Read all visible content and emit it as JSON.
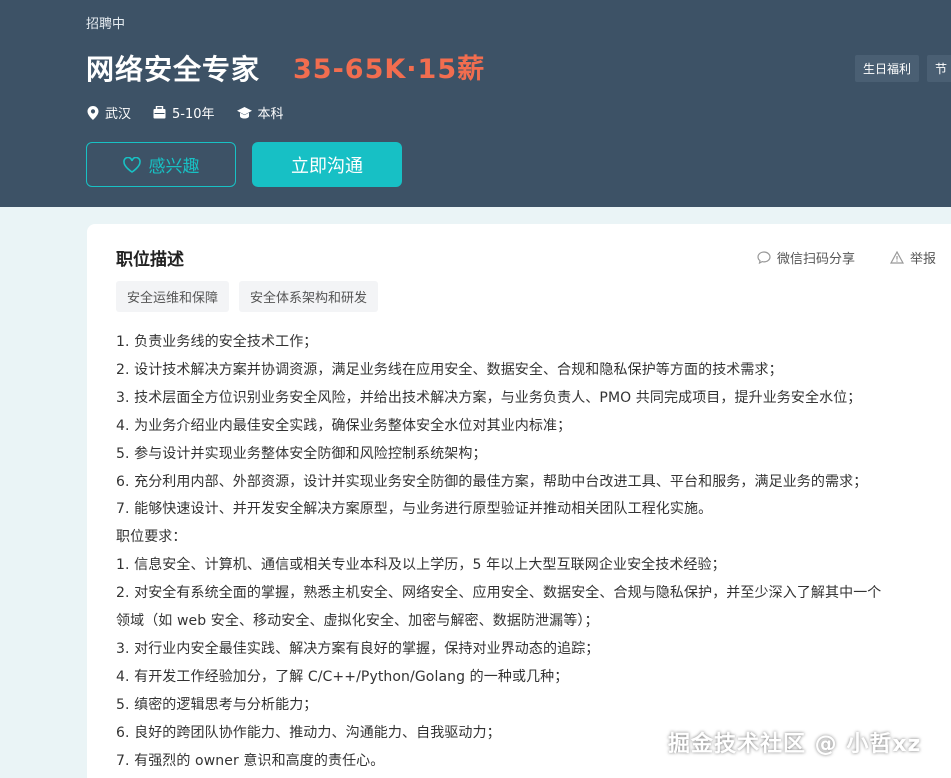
{
  "header": {
    "status": "招聘中",
    "title": "网络安全专家",
    "salary": "35-65K·15薪",
    "benefits": [
      "生日福利",
      "节"
    ],
    "meta": {
      "location": "武汉",
      "experience": "5-10年",
      "education": "本科"
    },
    "interest_label": "感兴趣",
    "chat_label": "立即沟通"
  },
  "job": {
    "section_title": "职位描述",
    "share_label": "微信扫码分享",
    "report_label": "举报",
    "tags": [
      "安全运维和保障",
      "安全体系架构和研发"
    ],
    "description_lines": [
      "1. 负责业务线的安全技术工作；",
      "2. 设计技术解决方案并协调资源，满足业务线在应用安全、数据安全、合规和隐私保护等方面的技术需求；",
      "3. 技术层面全方位识别业务安全风险，并给出技术解决方案，与业务负责人、PMO 共同完成项目，提升业务安全水位；",
      "4. 为业务介绍业内最佳安全实践，确保业务整体安全水位对其业内标准；",
      "5. 参与设计并实现业务整体安全防御和风险控制系统架构；",
      "6. 充分利用内部、外部资源，设计并实现业务安全防御的最佳方案，帮助中台改进工具、平台和服务，满足业务的需求；",
      "7. 能够快速设计、并开发安全解决方案原型，与业务进行原型验证并推动相关团队工程化实施。",
      "职位要求：",
      "1. 信息安全、计算机、通信或相关专业本科及以上学历，5 年以上大型互联网企业安全技术经验；",
      "2. 对安全有系统全面的掌握，熟悉主机安全、网络安全、应用安全、数据安全、合规与隐私保护，并至少深入了解其中一个",
      "领域（如 web 安全、移动安全、虚拟化安全、加密与解密、数据防泄漏等）；",
      "3. 对行业内安全最佳实践、解决方案有良好的掌握，保持对业界动态的追踪；",
      "4. 有开发工作经验加分，了解 C/C++/Python/Golang 的一种或几种；",
      "5. 缜密的逻辑思考与分析能力；",
      "6. 良好的跨团队协作能力、推动力、沟通能力、自我驱动力；",
      "7. 有强烈的 owner 意识和高度的责任心。"
    ]
  },
  "watermark": "掘金技术社区 @ 小哲xz",
  "colors": {
    "header_bg": "#3d5266",
    "salary": "#f26d4f",
    "accent": "#17c0c5"
  }
}
